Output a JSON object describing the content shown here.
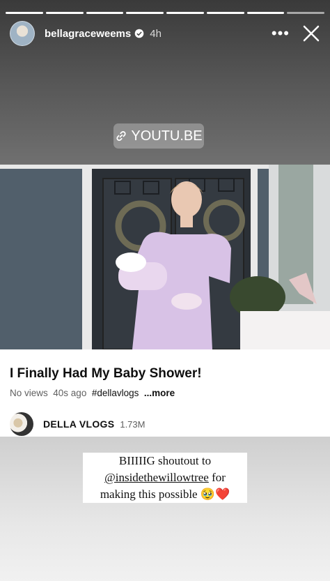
{
  "story": {
    "progress": {
      "total": 8,
      "current": 7
    },
    "username": "bellagraceweems",
    "time": "4h",
    "more_icon": "•••",
    "link_text": "YOUTU.BE"
  },
  "video": {
    "title": "I Finally Had My Baby Shower!",
    "views": "No views",
    "age": "40s ago",
    "hashtag": "#dellavlogs",
    "more": "...more",
    "channel_name": "DELLA VLOGS",
    "subscribers": "1.73M"
  },
  "caption": {
    "line1": "BIIIIIG shoutout to",
    "mention": "@insidethewillowtree",
    "line2_suffix": " for",
    "line3": "making this possible 🥹❤️"
  },
  "colors": {
    "text_dark": "#0f0f0f",
    "text_grey": "#606060",
    "dress": "#d8c2e6"
  }
}
